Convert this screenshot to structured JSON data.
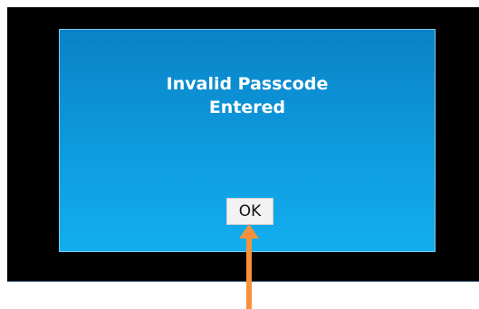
{
  "dialog": {
    "message_line1": "Invalid Passcode",
    "message_line2": "Entered",
    "ok_label": "OK"
  },
  "colors": {
    "screen_background": "#000000",
    "dialog_top": "#0a82c6",
    "dialog_bottom": "#13aeee",
    "annotation_arrow": "#f5923a"
  },
  "icons": {
    "annotation": "up-arrow-icon"
  }
}
